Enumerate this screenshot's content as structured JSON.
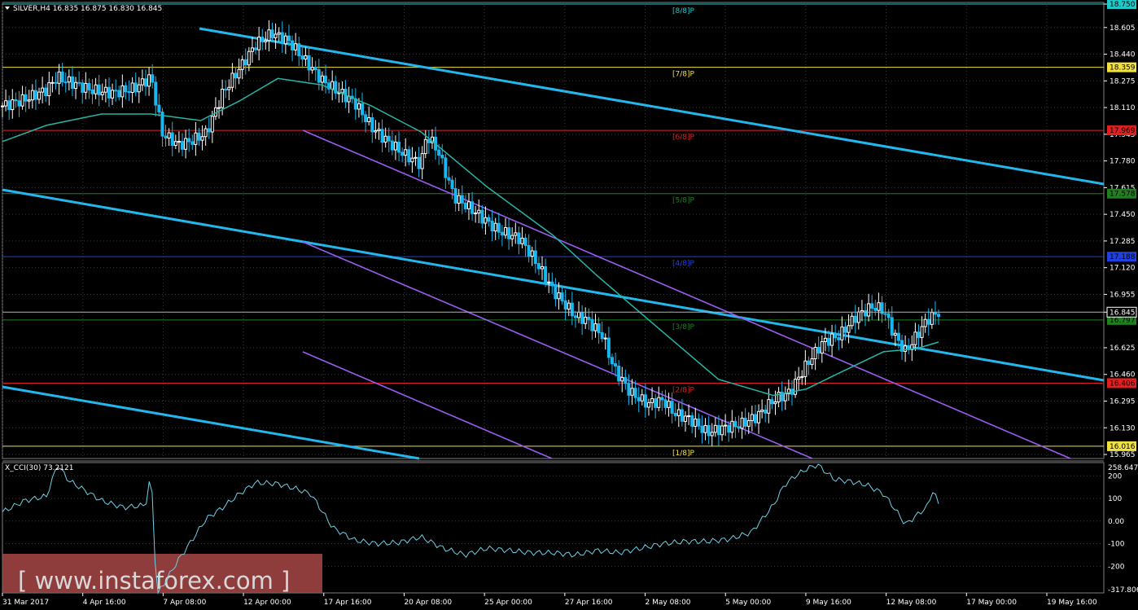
{
  "header": {
    "symbol_text": "SILVER,H4  16.835 16.875 16.830 16.845"
  },
  "indicator_header": {
    "text": "X_CCI(30) 73.2121"
  },
  "watermark": {
    "text": "[ www.instaforex.com ]"
  },
  "colors": {
    "background": "#000000",
    "grid": "#3a3a3a",
    "axis_text": "#ffffff",
    "bull_candle": "#ffffff",
    "bear_candle": "#19b7f0",
    "ma": "#26b5a6",
    "trend_cyan": "#22b8ee",
    "channel_purple": "#9b5cf0",
    "cci_line": "#6fd0e6",
    "watermark_bg": "#a84646"
  },
  "chart_data": [
    {
      "type": "candlestick",
      "title": "SILVER,H4",
      "ohlc": {
        "open": 16.835,
        "high": 16.875,
        "low": 16.83,
        "close": 16.845
      },
      "y_ticks": [
        "18.750",
        "18.605",
        "18.440",
        "18.275",
        "18.110",
        "17.945",
        "17.780",
        "17.615",
        "17.450",
        "17.285",
        "17.120",
        "16.955",
        "16.845",
        "16.625",
        "16.460",
        "16.295",
        "16.130",
        "15.965"
      ],
      "y_range": [
        15.94,
        18.76
      ],
      "x_ticks": [
        "31 Mar 2017",
        "4 Apr 16:00",
        "7 Apr 08:00",
        "12 Apr 00:00",
        "17 Apr 16:00",
        "20 Apr 08:00",
        "25 Apr 00:00",
        "27 Apr 16:00",
        "2 May 08:00",
        "5 May 00:00",
        "9 May 16:00",
        "12 May 08:00",
        "17 May 00:00",
        "19 May 16:00"
      ],
      "current_price": 16.845,
      "current_price_label": "16.845",
      "murrey_levels": [
        {
          "label": "[8/8]P",
          "price": 18.75,
          "box": "18.750",
          "color": "#20c8c8"
        },
        {
          "label": "[7/8]P",
          "price": 18.359,
          "box": "18.359",
          "color": "#f0e040"
        },
        {
          "label": "[6/8]P",
          "price": 17.969,
          "box": "17.969",
          "color": "#e02020"
        },
        {
          "label": "[5/8]P",
          "price": 17.578,
          "box": "17.578",
          "color": "#208020"
        },
        {
          "label": "[4/8]P",
          "price": 17.188,
          "box": "17.188",
          "color": "#2040e0"
        },
        {
          "label": "[3/8]P",
          "price": 16.797,
          "box": "16.797",
          "color": "#208020"
        },
        {
          "label": "[2/8]P",
          "price": 16.406,
          "box": "16.406",
          "color": "#e02020"
        },
        {
          "label": "[1/8]P",
          "price": 16.016,
          "box": "16.016",
          "color": "#f0e040"
        }
      ],
      "price_path": [
        [
          0,
          18.12
        ],
        [
          0.02,
          18.16
        ],
        [
          0.04,
          18.22
        ],
        [
          0.05,
          18.3
        ],
        [
          0.06,
          18.27
        ],
        [
          0.08,
          18.22
        ],
        [
          0.1,
          18.2
        ],
        [
          0.12,
          18.23
        ],
        [
          0.135,
          18.3
        ],
        [
          0.145,
          17.95
        ],
        [
          0.16,
          17.88
        ],
        [
          0.17,
          17.9
        ],
        [
          0.185,
          17.95
        ],
        [
          0.2,
          18.2
        ],
        [
          0.215,
          18.35
        ],
        [
          0.23,
          18.5
        ],
        [
          0.245,
          18.57
        ],
        [
          0.26,
          18.52
        ],
        [
          0.275,
          18.4
        ],
        [
          0.29,
          18.28
        ],
        [
          0.305,
          18.21
        ],
        [
          0.32,
          18.14
        ],
        [
          0.335,
          17.99
        ],
        [
          0.35,
          17.9
        ],
        [
          0.365,
          17.82
        ],
        [
          0.38,
          17.76
        ],
        [
          0.385,
          17.94
        ],
        [
          0.395,
          17.85
        ],
        [
          0.41,
          17.56
        ],
        [
          0.43,
          17.46
        ],
        [
          0.45,
          17.35
        ],
        [
          0.47,
          17.3
        ],
        [
          0.485,
          17.15
        ],
        [
          0.5,
          16.98
        ],
        [
          0.51,
          16.9
        ],
        [
          0.52,
          16.82
        ],
        [
          0.53,
          16.8
        ],
        [
          0.545,
          16.7
        ],
        [
          0.555,
          16.5
        ],
        [
          0.57,
          16.35
        ],
        [
          0.585,
          16.28
        ],
        [
          0.6,
          16.3
        ],
        [
          0.61,
          16.22
        ],
        [
          0.625,
          16.18
        ],
        [
          0.64,
          16.1
        ],
        [
          0.655,
          16.13
        ],
        [
          0.67,
          16.15
        ],
        [
          0.685,
          16.2
        ],
        [
          0.7,
          16.3
        ],
        [
          0.715,
          16.35
        ],
        [
          0.73,
          16.52
        ],
        [
          0.745,
          16.66
        ],
        [
          0.76,
          16.7
        ],
        [
          0.775,
          16.82
        ],
        [
          0.79,
          16.88
        ],
        [
          0.8,
          16.86
        ],
        [
          0.81,
          16.7
        ],
        [
          0.82,
          16.6
        ],
        [
          0.83,
          16.7
        ],
        [
          0.84,
          16.8
        ],
        [
          0.85,
          16.845
        ]
      ],
      "ma_path": [
        [
          0,
          17.9
        ],
        [
          0.04,
          18.0
        ],
        [
          0.09,
          18.07
        ],
        [
          0.135,
          18.07
        ],
        [
          0.18,
          18.03
        ],
        [
          0.215,
          18.15
        ],
        [
          0.25,
          18.29
        ],
        [
          0.29,
          18.25
        ],
        [
          0.335,
          18.12
        ],
        [
          0.38,
          17.96
        ],
        [
          0.44,
          17.62
        ],
        [
          0.5,
          17.32
        ],
        [
          0.54,
          17.07
        ],
        [
          0.6,
          16.72
        ],
        [
          0.65,
          16.43
        ],
        [
          0.7,
          16.33
        ],
        [
          0.73,
          16.37
        ],
        [
          0.76,
          16.47
        ],
        [
          0.8,
          16.6
        ],
        [
          0.83,
          16.62
        ],
        [
          0.85,
          16.66
        ]
      ]
    },
    {
      "type": "line",
      "title": "X_CCI(30) 73.2121",
      "current_value": 73.2121,
      "y_ticks": [
        "258.6475",
        "200",
        "100",
        "0.00",
        "-100",
        "-200",
        "-317.806"
      ],
      "y_range": [
        -317.806,
        258.6475
      ],
      "series": [
        {
          "values": [
            [
              0,
              40
            ],
            [
              0.02,
              90
            ],
            [
              0.04,
              110
            ],
            [
              0.05,
              250
            ],
            [
              0.06,
              180
            ],
            [
              0.07,
              150
            ],
            [
              0.09,
              90
            ],
            [
              0.11,
              60
            ],
            [
              0.13,
              70
            ],
            [
              0.135,
              220
            ],
            [
              0.14,
              -330
            ],
            [
              0.16,
              -170
            ],
            [
              0.17,
              -100
            ],
            [
              0.185,
              10
            ],
            [
              0.2,
              60
            ],
            [
              0.215,
              120
            ],
            [
              0.23,
              170
            ],
            [
              0.25,
              165
            ],
            [
              0.265,
              145
            ],
            [
              0.28,
              120
            ],
            [
              0.3,
              -30
            ],
            [
              0.32,
              -85
            ],
            [
              0.34,
              -100
            ],
            [
              0.36,
              -95
            ],
            [
              0.38,
              -70
            ],
            [
              0.4,
              -120
            ],
            [
              0.42,
              -150
            ],
            [
              0.44,
              -120
            ],
            [
              0.46,
              -130
            ],
            [
              0.48,
              -140
            ],
            [
              0.5,
              -140
            ],
            [
              0.52,
              -150
            ],
            [
              0.54,
              -130
            ],
            [
              0.56,
              -140
            ],
            [
              0.58,
              -120
            ],
            [
              0.6,
              -100
            ],
            [
              0.62,
              -90
            ],
            [
              0.64,
              -90
            ],
            [
              0.66,
              -80
            ],
            [
              0.68,
              -50
            ],
            [
              0.7,
              70
            ],
            [
              0.71,
              160
            ],
            [
              0.72,
              200
            ],
            [
              0.73,
              230
            ],
            [
              0.74,
              250
            ],
            [
              0.755,
              185
            ],
            [
              0.77,
              175
            ],
            [
              0.785,
              160
            ],
            [
              0.8,
              120
            ],
            [
              0.81,
              55
            ],
            [
              0.82,
              -15
            ],
            [
              0.83,
              25
            ],
            [
              0.84,
              65
            ],
            [
              0.845,
              140
            ],
            [
              0.85,
              73.2
            ]
          ]
        }
      ]
    }
  ]
}
